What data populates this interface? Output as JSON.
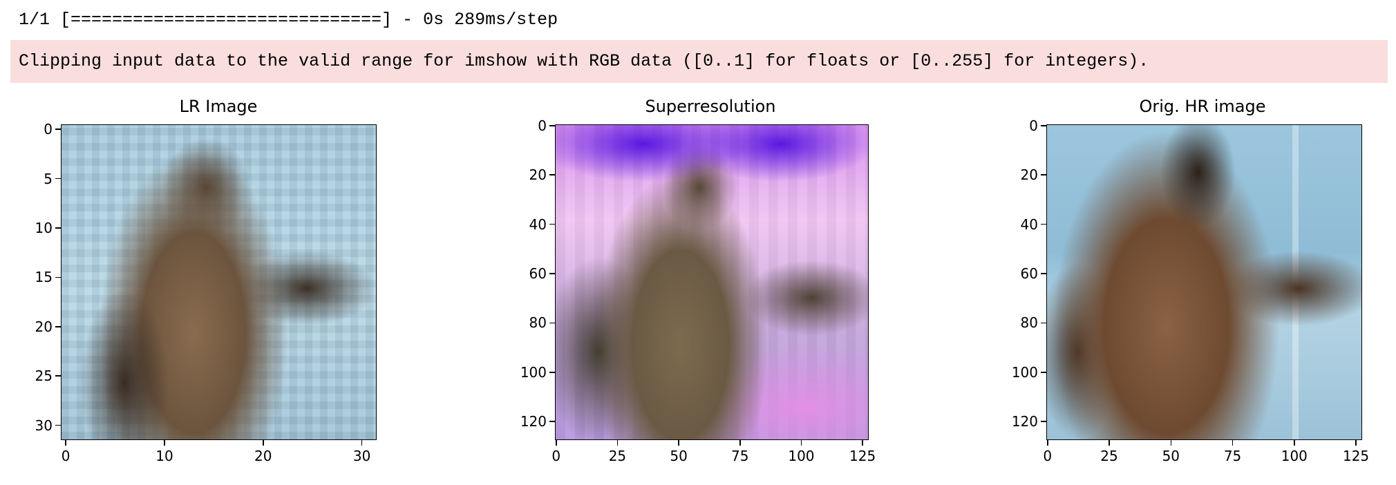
{
  "output": {
    "stdout": "1/1 [==============================] - 0s 289ms/step",
    "stderr": "Clipping input data to the valid range for imshow with RGB data ([0..1] for floats or [0..255] for integers)."
  },
  "figure": {
    "panels": [
      {
        "title": "LR Image",
        "image": "low-resolution pixelated image of a statue against a light blue building",
        "xticks": [
          "0",
          "10",
          "20",
          "30"
        ],
        "yticks": [
          "0",
          "5",
          "10",
          "15",
          "20",
          "25",
          "30"
        ],
        "extent": 32
      },
      {
        "title": "Superresolution",
        "image": "super-resolved reconstruction of the statue with purple and pink color artifacts",
        "xticks": [
          "0",
          "25",
          "50",
          "75",
          "100",
          "125"
        ],
        "yticks": [
          "0",
          "20",
          "40",
          "60",
          "80",
          "100",
          "120"
        ],
        "extent": 128
      },
      {
        "title": "Orig. HR image",
        "image": "original high-resolution photo of a bronze statue against a glass building",
        "xticks": [
          "0",
          "25",
          "50",
          "75",
          "100",
          "125"
        ],
        "yticks": [
          "0",
          "20",
          "40",
          "60",
          "80",
          "100",
          "120"
        ],
        "extent": 128
      }
    ]
  }
}
